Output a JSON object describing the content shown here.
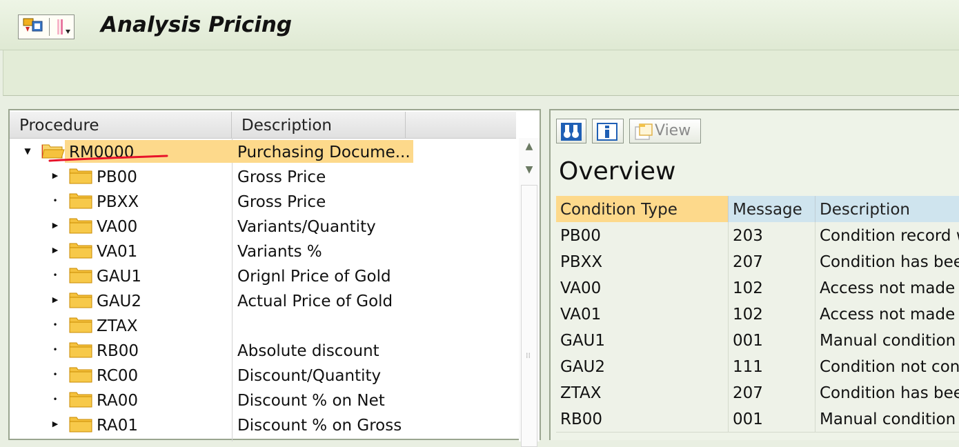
{
  "app": {
    "title": "Analysis Pricing"
  },
  "tree": {
    "columns": [
      "Procedure",
      "Description"
    ],
    "rows": [
      {
        "name": "RM0000",
        "description": "Purchasing Docume...",
        "expander": "expanded",
        "selected": true
      },
      {
        "name": "PB00",
        "description": "Gross Price",
        "expander": "collapsed"
      },
      {
        "name": "PBXX",
        "description": "Gross Price",
        "expander": "leaf"
      },
      {
        "name": "VA00",
        "description": "Variants/Quantity",
        "expander": "collapsed"
      },
      {
        "name": "VA01",
        "description": "Variants %",
        "expander": "collapsed"
      },
      {
        "name": "GAU1",
        "description": "Orignl Price of Gold",
        "expander": "leaf"
      },
      {
        "name": "GAU2",
        "description": "Actual Price of Gold",
        "expander": "collapsed"
      },
      {
        "name": "ZTAX",
        "description": "",
        "expander": "leaf"
      },
      {
        "name": "RB00",
        "description": "Absolute discount",
        "expander": "leaf"
      },
      {
        "name": "RC00",
        "description": "Discount/Quantity",
        "expander": "leaf"
      },
      {
        "name": "RA00",
        "description": "Discount % on Net",
        "expander": "leaf"
      },
      {
        "name": "RA01",
        "description": "Discount % on Gross",
        "expander": "collapsed"
      }
    ]
  },
  "detail": {
    "toolbar": {
      "find_icon": "binoculars-icon",
      "info_icon": "info-icon",
      "view_label": "View"
    },
    "heading": "Overview",
    "columns": [
      "Condition Type",
      "Message",
      "Description"
    ],
    "rows": [
      {
        "condition_type": "PB00",
        "message": "203",
        "description": "Condition record w"
      },
      {
        "condition_type": "PBXX",
        "message": "207",
        "description": "Condition has beer"
      },
      {
        "condition_type": "VA00",
        "message": "102",
        "description": "Access not made ("
      },
      {
        "condition_type": "VA01",
        "message": "102",
        "description": "Access not made ("
      },
      {
        "condition_type": "GAU1",
        "message": "001",
        "description": "Manual condition"
      },
      {
        "condition_type": "GAU2",
        "message": "111",
        "description": "Condition not cons"
      },
      {
        "condition_type": "ZTAX",
        "message": "207",
        "description": "Condition has beer"
      },
      {
        "condition_type": "RB00",
        "message": "001",
        "description": "Manual condition"
      }
    ]
  },
  "colors": {
    "selected_row": "#fdd98b",
    "folder": "#f5c23e",
    "annotation_underline": "#e8132a",
    "grid_header": "#cfe4ee"
  }
}
